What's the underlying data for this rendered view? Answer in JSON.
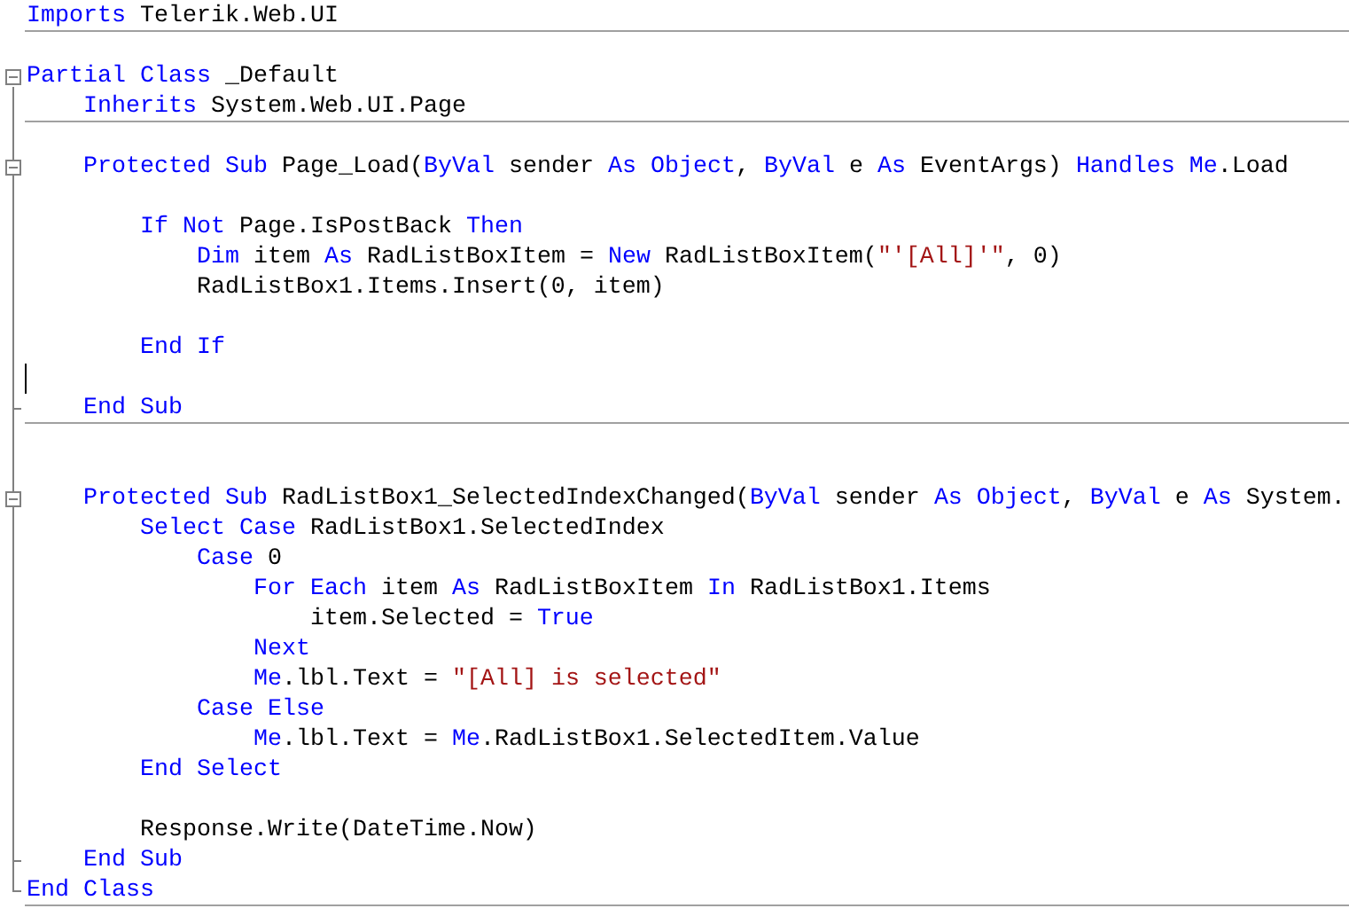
{
  "editor": {
    "lines": [
      {
        "kind": "code",
        "tokens": [
          {
            "kind": "keyword",
            "text": "Imports"
          },
          {
            "kind": "plain",
            "text": " Telerik.Web.UI"
          }
        ],
        "separator": true
      },
      {
        "kind": "blank"
      },
      {
        "kind": "code",
        "tokens": [
          {
            "kind": "keyword",
            "text": "Partial Class"
          },
          {
            "kind": "plain",
            "text": " _Default"
          }
        ],
        "fold": {
          "kind": "start",
          "expanded": true
        }
      },
      {
        "kind": "code",
        "tokens": [
          {
            "kind": "keyword",
            "text": "    Inherits"
          },
          {
            "kind": "plain",
            "text": " System.Web.UI.Page"
          }
        ],
        "separator": true
      },
      {
        "kind": "blank"
      },
      {
        "kind": "code",
        "tokens": [
          {
            "kind": "keyword",
            "text": "    Protected Sub"
          },
          {
            "kind": "plain",
            "text": " Page_Load("
          },
          {
            "kind": "keyword",
            "text": "ByVal"
          },
          {
            "kind": "plain",
            "text": " sender "
          },
          {
            "kind": "keyword",
            "text": "As Object"
          },
          {
            "kind": "plain",
            "text": ", "
          },
          {
            "kind": "keyword",
            "text": "ByVal"
          },
          {
            "kind": "plain",
            "text": " e "
          },
          {
            "kind": "keyword",
            "text": "As"
          },
          {
            "kind": "plain",
            "text": " EventArgs) "
          },
          {
            "kind": "keyword",
            "text": "Handles Me"
          },
          {
            "kind": "plain",
            "text": ".Load"
          }
        ],
        "fold": {
          "kind": "start",
          "expanded": true
        }
      },
      {
        "kind": "blank"
      },
      {
        "kind": "code",
        "tokens": [
          {
            "kind": "keyword",
            "text": "        If Not"
          },
          {
            "kind": "plain",
            "text": " Page.IsPostBack "
          },
          {
            "kind": "keyword",
            "text": "Then"
          }
        ]
      },
      {
        "kind": "code",
        "tokens": [
          {
            "kind": "keyword",
            "text": "            Dim"
          },
          {
            "kind": "plain",
            "text": " item "
          },
          {
            "kind": "keyword",
            "text": "As"
          },
          {
            "kind": "plain",
            "text": " RadListBoxItem = "
          },
          {
            "kind": "keyword",
            "text": "New"
          },
          {
            "kind": "plain",
            "text": " RadListBoxItem("
          },
          {
            "kind": "string",
            "text": "\"'[All]'\""
          },
          {
            "kind": "plain",
            "text": ", 0)"
          }
        ]
      },
      {
        "kind": "code",
        "tokens": [
          {
            "kind": "plain",
            "text": "            RadListBox1.Items.Insert(0, item)"
          }
        ]
      },
      {
        "kind": "blank"
      },
      {
        "kind": "code",
        "tokens": [
          {
            "kind": "keyword",
            "text": "        End If"
          }
        ]
      },
      {
        "kind": "blank",
        "caret": true
      },
      {
        "kind": "code",
        "tokens": [
          {
            "kind": "keyword",
            "text": "    End Sub"
          }
        ],
        "separator": true,
        "fold": {
          "kind": "end"
        }
      },
      {
        "kind": "blank"
      },
      {
        "kind": "blank"
      },
      {
        "kind": "code",
        "tokens": [
          {
            "kind": "keyword",
            "text": "    Protected Sub"
          },
          {
            "kind": "plain",
            "text": " RadListBox1_SelectedIndexChanged("
          },
          {
            "kind": "keyword",
            "text": "ByVal"
          },
          {
            "kind": "plain",
            "text": " sender "
          },
          {
            "kind": "keyword",
            "text": "As Object"
          },
          {
            "kind": "plain",
            "text": ", "
          },
          {
            "kind": "keyword",
            "text": "ByVal"
          },
          {
            "kind": "plain",
            "text": " e "
          },
          {
            "kind": "keyword",
            "text": "As"
          },
          {
            "kind": "plain",
            "text": " System."
          }
        ],
        "fold": {
          "kind": "start",
          "expanded": true
        }
      },
      {
        "kind": "code",
        "tokens": [
          {
            "kind": "keyword",
            "text": "        Select Case"
          },
          {
            "kind": "plain",
            "text": " RadListBox1.SelectedIndex"
          }
        ]
      },
      {
        "kind": "code",
        "tokens": [
          {
            "kind": "keyword",
            "text": "            Case"
          },
          {
            "kind": "plain",
            "text": " 0"
          }
        ]
      },
      {
        "kind": "code",
        "tokens": [
          {
            "kind": "keyword",
            "text": "                For Each"
          },
          {
            "kind": "plain",
            "text": " item "
          },
          {
            "kind": "keyword",
            "text": "As"
          },
          {
            "kind": "plain",
            "text": " RadListBoxItem "
          },
          {
            "kind": "keyword",
            "text": "In"
          },
          {
            "kind": "plain",
            "text": " RadListBox1.Items"
          }
        ]
      },
      {
        "kind": "code",
        "tokens": [
          {
            "kind": "plain",
            "text": "                    item.Selected = "
          },
          {
            "kind": "keyword",
            "text": "True"
          }
        ]
      },
      {
        "kind": "code",
        "tokens": [
          {
            "kind": "keyword",
            "text": "                Next"
          }
        ]
      },
      {
        "kind": "code",
        "tokens": [
          {
            "kind": "keyword",
            "text": "                Me"
          },
          {
            "kind": "plain",
            "text": ".lbl.Text = "
          },
          {
            "kind": "string",
            "text": "\"[All] is selected\""
          }
        ]
      },
      {
        "kind": "code",
        "tokens": [
          {
            "kind": "keyword",
            "text": "            Case Else"
          }
        ]
      },
      {
        "kind": "code",
        "tokens": [
          {
            "kind": "keyword",
            "text": "                Me"
          },
          {
            "kind": "plain",
            "text": ".lbl.Text = "
          },
          {
            "kind": "keyword",
            "text": "Me"
          },
          {
            "kind": "plain",
            "text": ".RadListBox1.SelectedItem.Value"
          }
        ]
      },
      {
        "kind": "code",
        "tokens": [
          {
            "kind": "keyword",
            "text": "        End Select"
          }
        ]
      },
      {
        "kind": "blank"
      },
      {
        "kind": "code",
        "tokens": [
          {
            "kind": "plain",
            "text": "        Response.Write(DateTime.Now)"
          }
        ]
      },
      {
        "kind": "code",
        "tokens": [
          {
            "kind": "keyword",
            "text": "    End Sub"
          }
        ],
        "fold": {
          "kind": "end"
        }
      },
      {
        "kind": "code",
        "tokens": [
          {
            "kind": "keyword",
            "text": "End Class"
          }
        ],
        "separator": true,
        "fold": {
          "kind": "end"
        }
      }
    ]
  }
}
